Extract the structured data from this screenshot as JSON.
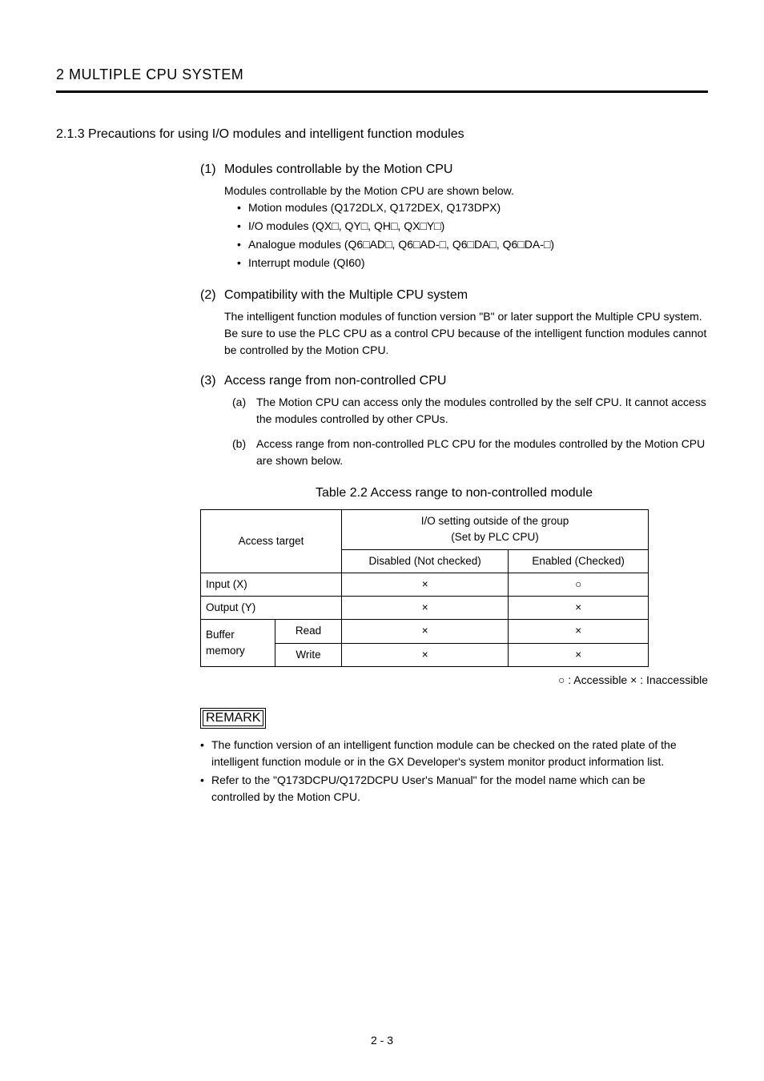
{
  "chapter": "2  MULTIPLE CPU SYSTEM",
  "section_title": "2.1.3 Precautions for using I/O modules and intelligent function modules",
  "items": {
    "i1": {
      "num": "(1)",
      "heading": "Modules controllable by the Motion CPU",
      "desc": "Modules controllable by the Motion CPU are shown below.",
      "bullets": {
        "b0": "Motion modules (Q172DLX, Q172DEX, Q173DPX)",
        "b1": "I/O modules (QX□, QY□, QH□, QX□Y□)",
        "b2": "Analogue modules (Q6□AD□, Q6□AD-□, Q6□DA□, Q6□DA-□)",
        "b3": "Interrupt module (QI60)"
      }
    },
    "i2": {
      "num": "(2)",
      "heading": "Compatibility with the Multiple CPU system",
      "desc": "The intelligent function modules of function version \"B\" or later support the Multiple CPU system. Be sure to use the PLC CPU as a control CPU because of the intelligent function modules cannot be controlled by the Motion CPU."
    },
    "i3": {
      "num": "(3)",
      "heading": "Access range from non-controlled CPU",
      "a": {
        "label": "(a)",
        "text": "The Motion CPU can access only the modules controlled by the self CPU. It cannot access the modules controlled by other CPUs."
      },
      "b": {
        "label": "(b)",
        "text": "Access range from non-controlled PLC CPU for the modules controlled by the Motion CPU are shown below."
      }
    }
  },
  "table": {
    "caption": "Table 2.2 Access range to non-controlled module",
    "header": {
      "target": "Access target",
      "group_top": "I/O setting outside of the group",
      "group_sub": "(Set by PLC CPU)",
      "disabled": "Disabled (Not checked)",
      "enabled": "Enabled (Checked)"
    },
    "rows": {
      "r0": {
        "label": "Input (X)",
        "col2": "",
        "disabled": "×",
        "enabled": "○"
      },
      "r1": {
        "label": "Output (Y)",
        "col2": "",
        "disabled": "×",
        "enabled": "×"
      },
      "r2g": {
        "label": "Buffer memory"
      },
      "r2": {
        "label2": "Read",
        "disabled": "×",
        "enabled": "×"
      },
      "r3": {
        "label2": "Write",
        "disabled": "×",
        "enabled": "×"
      }
    },
    "legend": "○ : Accessible   × : Inaccessible"
  },
  "remark": {
    "title": "REMARK",
    "b0": "The function version of an intelligent function module can be checked on the rated plate of the intelligent function module or in the GX Developer's system monitor product information list.",
    "b1": "Refer to the \"Q173DCPU/Q172DCPU User's Manual\" for the model name which can be controlled by the Motion CPU."
  },
  "footer": "2 - 3"
}
